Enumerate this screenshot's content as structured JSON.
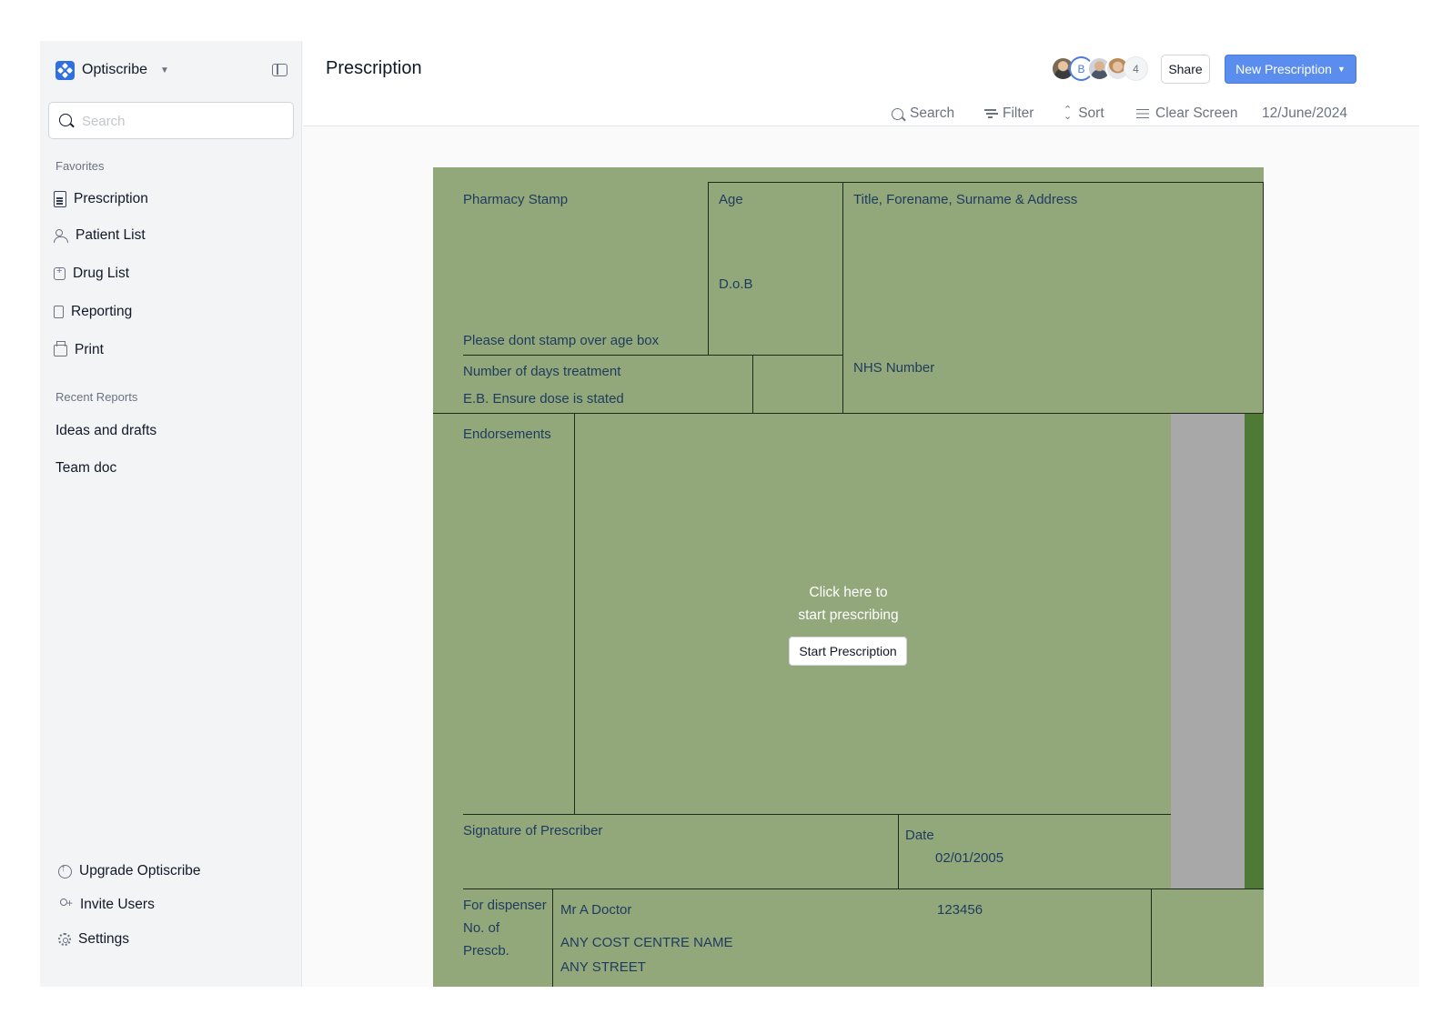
{
  "sidebar": {
    "brand": "Optiscribe",
    "search_placeholder": "Search",
    "favorites_label": "Favorites",
    "items": [
      {
        "label": "Prescription",
        "icon": "document-icon"
      },
      {
        "label": "Patient List",
        "icon": "users-icon"
      },
      {
        "label": "Drug List",
        "icon": "drug-icon"
      },
      {
        "label": "Reporting",
        "icon": "report-icon"
      },
      {
        "label": "Print",
        "icon": "printer-icon"
      }
    ],
    "recent_label": "Recent Reports",
    "recent": [
      "Ideas and drafts",
      "Team doc"
    ],
    "footer": [
      {
        "label": "Upgrade Optiscribe",
        "icon": "upgrade-icon"
      },
      {
        "label": "Invite Users",
        "icon": "invite-user-icon"
      },
      {
        "label": "Settings",
        "icon": "gear-icon"
      }
    ]
  },
  "header": {
    "title": "Prescription",
    "avatar_letter": "B",
    "avatar_count": "4",
    "share_label": "Share",
    "new_label": "New Prescription"
  },
  "toolbar": {
    "search": "Search",
    "filter": "Filter",
    "sort": "Sort",
    "clear": "Clear Screen",
    "date": "12/June/2024"
  },
  "form": {
    "pharmacy_stamp": "Pharmacy Stamp",
    "age": "Age",
    "patient_details": "Title, Forename, Surname & Address",
    "dob": "D.o.B",
    "stamp_note": "Please dont stamp over age box",
    "days_treatment": "Number of days treatment",
    "dose_note": "E.B. Ensure dose is stated",
    "nhs_number": "NHS Number",
    "endorsements": "Endorsements",
    "cta_line1": "Click here to",
    "cta_line2": "start prescribing",
    "start_button": "Start Prescription",
    "signature": "Signature of Prescriber",
    "date_label": "Date",
    "date_value": "02/01/2005",
    "dispenser_line1": "For dispenser",
    "dispenser_line2": "No. of",
    "dispenser_line3": "Prescb.",
    "doctor_name": "Mr A Doctor",
    "doctor_code": "123456",
    "cost_centre": "ANY COST CENTRE NAME",
    "street": "ANY STREET"
  },
  "colors": {
    "accent": "#5b8def",
    "form_background": "#92a87a",
    "form_text": "#1e3a5f",
    "grey_strip": "#a8a8a8",
    "green_strip": "#4e7a35"
  }
}
